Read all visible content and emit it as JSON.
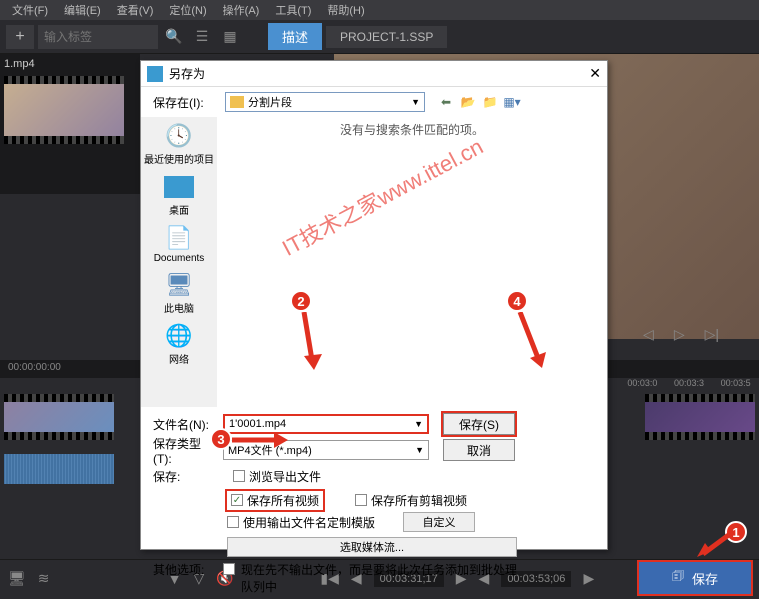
{
  "menubar": {
    "file": "文件(F)",
    "edit": "编辑(E)",
    "view": "查看(V)",
    "locate": "定位(N)",
    "operate": "操作(A)",
    "tools": "工具(T)",
    "help": "帮助(H)"
  },
  "toolbar": {
    "tag_placeholder": "输入标签",
    "tab_active": "描述",
    "tab_project": "PROJECT-1.SSP"
  },
  "media": {
    "clip": "1.mp4"
  },
  "preview_controls": {
    "prev": "◁",
    "play": "▷",
    "next": "▷|"
  },
  "timeline": {
    "ruler_start": "00:00:00:00",
    "r1": "00:03:0",
    "r2": "00:03:3",
    "r3": "00:03:5"
  },
  "bottombar": {
    "tc1": "00:03:31;17",
    "tc2": "00:03:53;06",
    "save_btn": "保存"
  },
  "dialog": {
    "title": "另存为",
    "store_in_label": "保存在(I):",
    "folder": "分割片段",
    "empty_msg": "没有与搜索条件匹配的项。",
    "sidebar": {
      "recent": "最近使用的项目",
      "desktop": "桌面",
      "documents": "Documents",
      "pc": "此电脑",
      "network": "网络"
    },
    "filename_label": "文件名(N):",
    "filename_value": "1'0001.mp4",
    "filetype_label": "保存类型(T):",
    "filetype_value": "MP4文件 (*.mp4)",
    "save_btn": "保存(S)",
    "cancel_btn": "取消",
    "save_label": "保存:",
    "chk_browse_export": "浏览导出文件",
    "chk_save_all_video": "保存所有视频",
    "chk_save_clips": "保存所有剪辑视频",
    "chk_use_output_template": "使用输出文件名定制模版",
    "custom_btn": "自定义",
    "select_media_btn": "选取媒体流...",
    "other_label": "其他选项:",
    "chk_batch": "现在先不输出文件，而是要将此次任务添加到批处理队列中"
  },
  "watermark": "IT技术之家www.ittel.cn"
}
